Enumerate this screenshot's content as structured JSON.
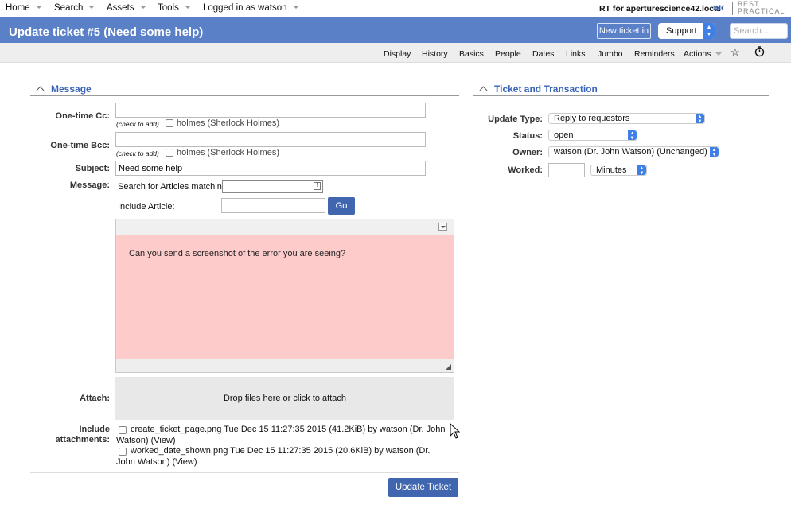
{
  "top_menu": {
    "home": "Home",
    "search": "Search",
    "assets": "Assets",
    "tools": "Tools",
    "logged_in": "Logged in as watson",
    "rt_for": "RT for aperturescience42.local",
    "logo_line1": "BEST",
    "logo_line2": "PRACTICAL"
  },
  "header": {
    "title": "Update ticket #5 (Need some help)",
    "new_ticket_label": "New ticket in",
    "queue_selected": "Support",
    "search_placeholder": "Search..."
  },
  "page_menu": {
    "items": [
      "Display",
      "History",
      "Basics",
      "People",
      "Dates",
      "Links",
      "Jumbo",
      "Reminders",
      "Actions"
    ],
    "star_icon": "star-icon",
    "timer_icon": "stopwatch-icon"
  },
  "message_section": {
    "title": "Message",
    "cc_label": "One-time Cc:",
    "bcc_label": "One-time Bcc:",
    "check_to_add": "(check to add)",
    "holmes": "holmes (Sherlock Holmes)",
    "subject_label": "Subject:",
    "subject_value": "Need some help",
    "message_label": "Message:",
    "search_articles_label": "Search for Articles matching",
    "include_article_label": "Include Article:",
    "go_label": "Go",
    "editor_text": "Can you send a screenshot of the error you are seeing?",
    "attach_label": "Attach:",
    "dropzone_text": "Drop files here or click to attach",
    "include_attachments_label1": "Include",
    "include_attachments_label2": "attachments:",
    "attachment1": "create_ticket_page.png Tue Dec 15 11:27:35 2015 (41.2KiB) by watson (Dr. John Watson) (View)",
    "attachment2": "worked_date_shown.png Tue Dec 15 11:27:35 2015 (20.6KiB) by watson (Dr. John Watson) (View)",
    "update_button": "Update Ticket"
  },
  "ticket_section": {
    "title": "Ticket and Transaction",
    "update_type_label": "Update Type:",
    "update_type_value": "Reply to requestors",
    "status_label": "Status:",
    "status_value": "open",
    "owner_label": "Owner:",
    "owner_value": "watson (Dr. John Watson) (Unchanged)",
    "worked_label": "Worked:",
    "worked_unit": "Minutes"
  },
  "colors": {
    "header_blue": "#5a80c8",
    "section_title": "#3a64b8",
    "button_blue": "#4166b0",
    "editor_bg": "#fecbcb"
  }
}
